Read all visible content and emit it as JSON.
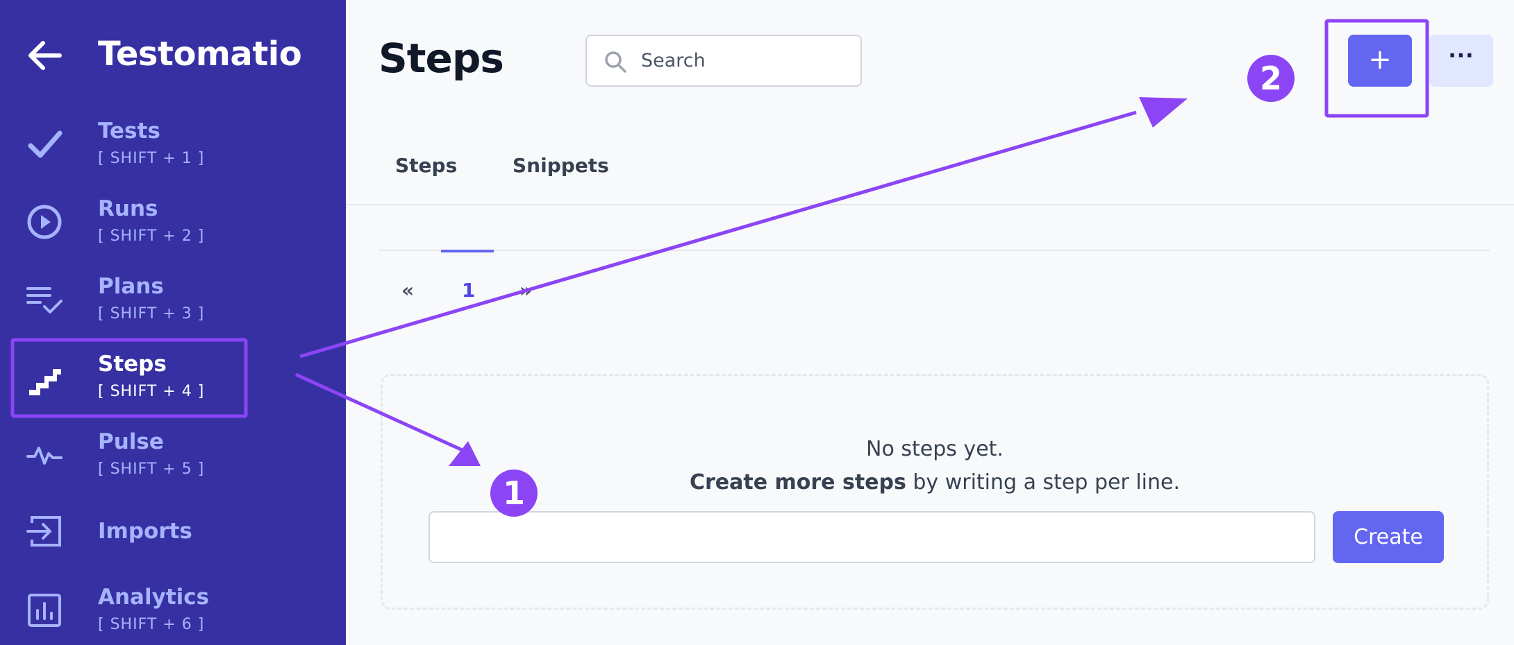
{
  "app": {
    "name": "Testomatio"
  },
  "sidebar": {
    "items": [
      {
        "label": "Tests",
        "hint": "[ SHIFT + 1 ]",
        "icon": "check-icon"
      },
      {
        "label": "Runs",
        "hint": "[ SHIFT + 2 ]",
        "icon": "play-circle-icon"
      },
      {
        "label": "Plans",
        "hint": "[ SHIFT + 3 ]",
        "icon": "list-check-icon"
      },
      {
        "label": "Steps",
        "hint": "[ SHIFT + 4 ]",
        "icon": "stairs-icon",
        "active": true
      },
      {
        "label": "Pulse",
        "hint": "[ SHIFT + 5 ]",
        "icon": "pulse-icon"
      },
      {
        "label": "Imports",
        "hint": "",
        "icon": "import-icon"
      },
      {
        "label": "Analytics",
        "hint": "[ SHIFT + 6 ]",
        "icon": "analytics-icon"
      }
    ]
  },
  "header": {
    "title": "Steps",
    "search_placeholder": "Search",
    "add_label": "+",
    "more_label": "···"
  },
  "tabs": [
    {
      "label": "Steps"
    },
    {
      "label": "Snippets"
    }
  ],
  "pagination": {
    "prev": "«",
    "current": "1",
    "next": "»"
  },
  "empty_state": {
    "message": "No steps yet.",
    "hint_bold": "Create more steps",
    "hint_rest": " by writing a step per line.",
    "input_value": "",
    "create_label": "Create"
  },
  "annotations": {
    "badge_1": "1",
    "badge_2": "2",
    "color": "#8b45f5"
  },
  "colors": {
    "sidebar_bg": "#3730a3",
    "accent": "#6366f1",
    "sidebar_text": "#a5b4fc"
  }
}
